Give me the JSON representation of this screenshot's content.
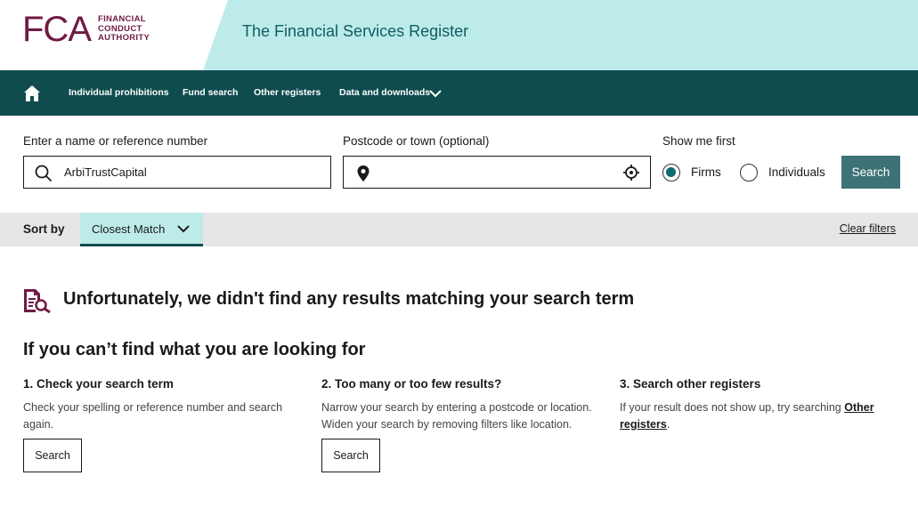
{
  "header": {
    "logo_mark": "FCA",
    "logo_lines": [
      "FINANCIAL",
      "CONDUCT",
      "AUTHORITY"
    ],
    "site_title": "The Financial Services Register"
  },
  "nav": {
    "items": [
      "Individual prohibitions",
      "Fund search",
      "Other registers",
      "Data and downloads"
    ]
  },
  "search": {
    "name_label": "Enter a name or reference number",
    "name_value": "ArbiTrustCapital",
    "postcode_label": "Postcode or town (optional)",
    "postcode_value": "",
    "show_first_label": "Show me first",
    "options": [
      "Firms",
      "Individuals"
    ],
    "selected_option": "Firms",
    "button_label": "Search"
  },
  "sort": {
    "label": "Sort by",
    "value": "Closest Match",
    "clear_label": "Clear filters"
  },
  "results": {
    "no_results_message": "Unfortunately, we didn't find any results matching your search term",
    "help_title": "If you can’t find what you are looking for",
    "columns": [
      {
        "title": "1. Check your search term",
        "text": "Check your spelling or reference number and search again.",
        "button": "Search"
      },
      {
        "title": "2. Too many or too few results?",
        "text": "Narrow your search by entering a postcode or location. Widen your search by removing filters like location.",
        "button": "Search"
      },
      {
        "title": "3. Search other registers",
        "text_before": "If your result does not show up, try searching ",
        "link": "Other registers",
        "text_after": "."
      }
    ]
  },
  "colors": {
    "brand": "#701b45",
    "nav_bg": "#0f4c4f",
    "header_teal": "#bdebe9",
    "button": "#3e7276"
  }
}
